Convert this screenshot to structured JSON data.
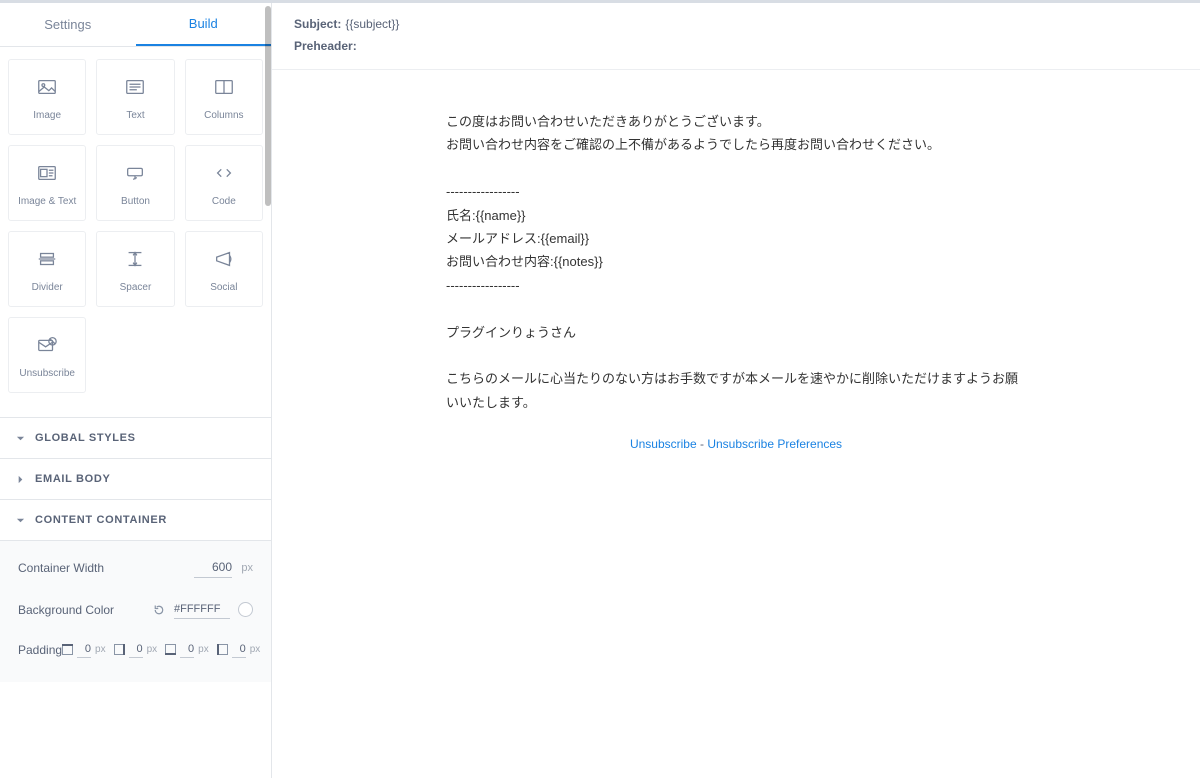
{
  "tabs": {
    "settings": "Settings",
    "build": "Build"
  },
  "modules": [
    {
      "id": "image",
      "label": "Image"
    },
    {
      "id": "text",
      "label": "Text"
    },
    {
      "id": "columns",
      "label": "Columns"
    },
    {
      "id": "image-text",
      "label": "Image & Text"
    },
    {
      "id": "button",
      "label": "Button"
    },
    {
      "id": "code",
      "label": "Code"
    },
    {
      "id": "divider",
      "label": "Divider"
    },
    {
      "id": "spacer",
      "label": "Spacer"
    },
    {
      "id": "social",
      "label": "Social"
    },
    {
      "id": "unsubscribe",
      "label": "Unsubscribe"
    }
  ],
  "sections": {
    "global_styles": {
      "title": "GLOBAL STYLES",
      "expanded": true
    },
    "email_body": {
      "title": "EMAIL BODY",
      "expanded": false
    },
    "content_container": {
      "title": "CONTENT CONTAINER",
      "expanded": true,
      "width_label": "Container Width",
      "width_value": "600",
      "width_unit": "px",
      "bg_label": "Background Color",
      "bg_value": "#FFFFFF",
      "padding_label": "Padding",
      "padding": {
        "top": "0",
        "right": "0",
        "bottom": "0",
        "left": "0",
        "unit": "px"
      }
    }
  },
  "meta": {
    "subject_label": "Subject:",
    "subject_value": "{{subject}}",
    "preheader_label": "Preheader:",
    "preheader_value": ""
  },
  "email": {
    "line1": "この度はお問い合わせいただきありがとうございます。",
    "line2": "お問い合わせ内容をご確認の上不備があるようでしたら再度お問い合わせください。",
    "sep": "-----------------",
    "name_line": "氏名:{{name}}",
    "email_line": "メールアドレス:{{email}}",
    "notes_line": "お問い合わせ内容:{{notes}}",
    "signature": "プラグインりょうさん",
    "footer": "こちらのメールに心当たりのない方はお手数ですが本メールを速やかに削除いただけますようお願いいたします。"
  },
  "unsub": {
    "unsubscribe": "Unsubscribe",
    "separator": " - ",
    "preferences": "Unsubscribe Preferences"
  }
}
